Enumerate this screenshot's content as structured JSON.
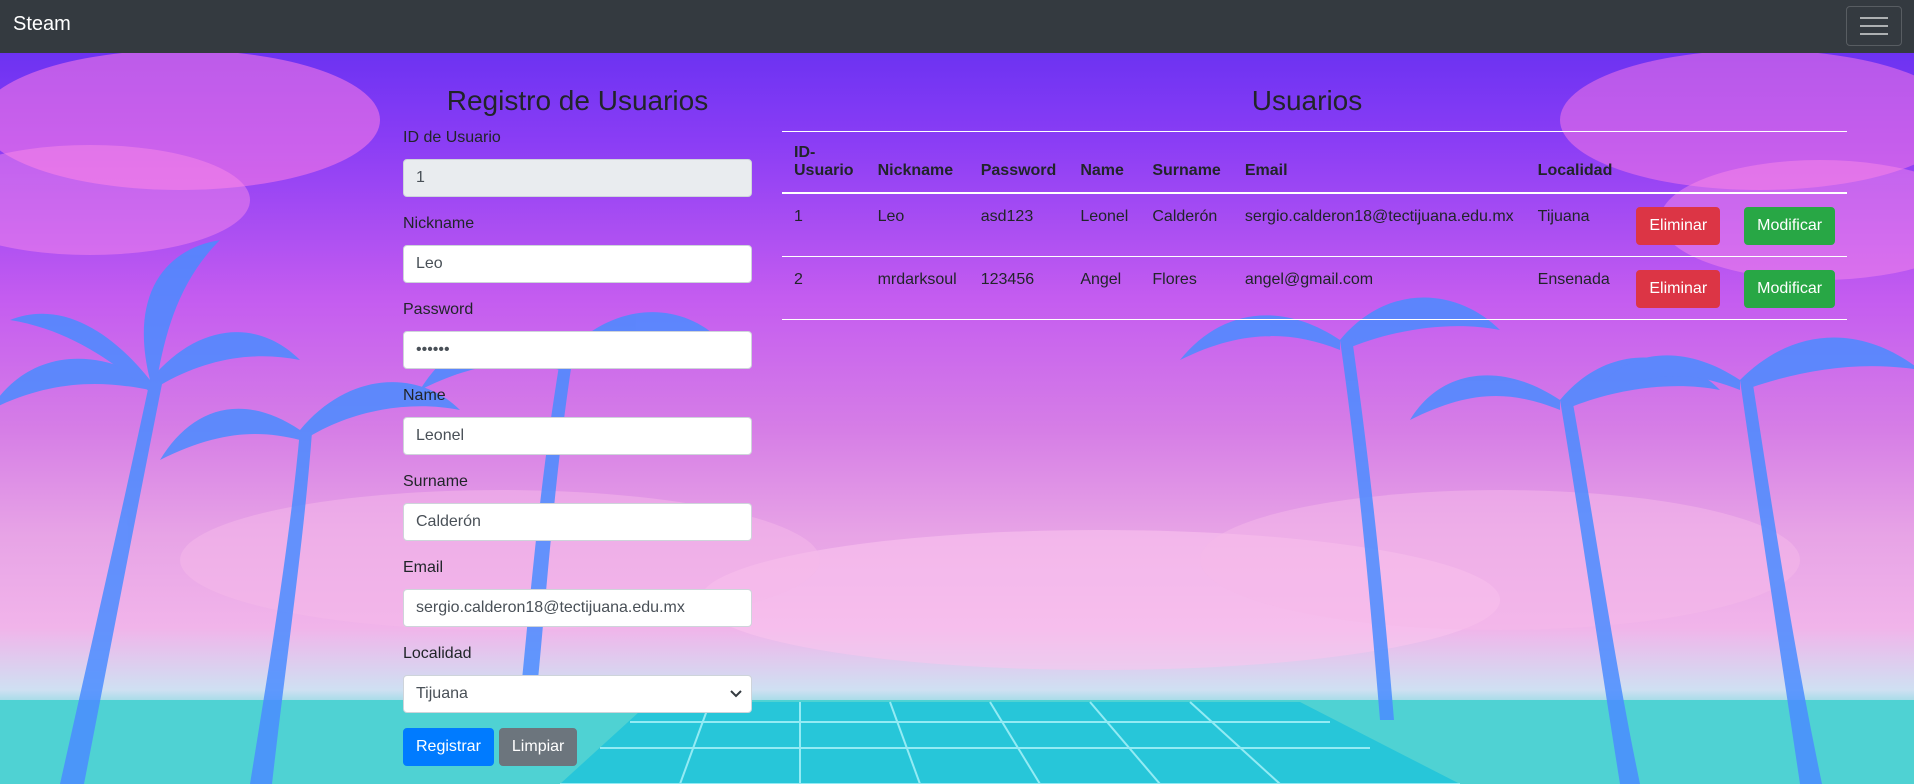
{
  "navbar": {
    "brand": "Steam",
    "toggle_icon": "hamburger-icon"
  },
  "form": {
    "title": "Registro de Usuarios",
    "fields": {
      "id": {
        "label": "ID de Usuario",
        "value": "1"
      },
      "nickname": {
        "label": "Nickname",
        "value": "Leo"
      },
      "password": {
        "label": "Password",
        "value": "••••••"
      },
      "name": {
        "label": "Name",
        "value": "Leonel"
      },
      "surname": {
        "label": "Surname",
        "value": "Calderón"
      },
      "email": {
        "label": "Email",
        "value": "sergio.calderon18@tectijuana.edu.mx"
      },
      "localidad": {
        "label": "Localidad",
        "value": "Tijuana"
      }
    },
    "buttons": {
      "register": "Registrar",
      "clear": "Limpiar"
    }
  },
  "table": {
    "title": "Usuarios",
    "headers": [
      "ID-Usuario",
      "Nickname",
      "Password",
      "Name",
      "Surname",
      "Email",
      "Localidad"
    ],
    "rows": [
      {
        "id": "1",
        "nickname": "Leo",
        "password": "asd123",
        "name": "Leonel",
        "surname": "Calderón",
        "email": "sergio.calderon18@tectijuana.edu.mx",
        "localidad": "Tijuana"
      },
      {
        "id": "2",
        "nickname": "mrdarksoul",
        "password": "123456",
        "name": "Angel",
        "surname": "Flores",
        "email": "angel@gmail.com",
        "localidad": "Ensenada"
      }
    ],
    "actions": {
      "delete": "Eliminar",
      "modify": "Modificar"
    }
  },
  "colors": {
    "navbar": "#343a40",
    "primary": "#007bff",
    "secondary": "#6c757d",
    "danger": "#dc3545",
    "success": "#28a745"
  }
}
